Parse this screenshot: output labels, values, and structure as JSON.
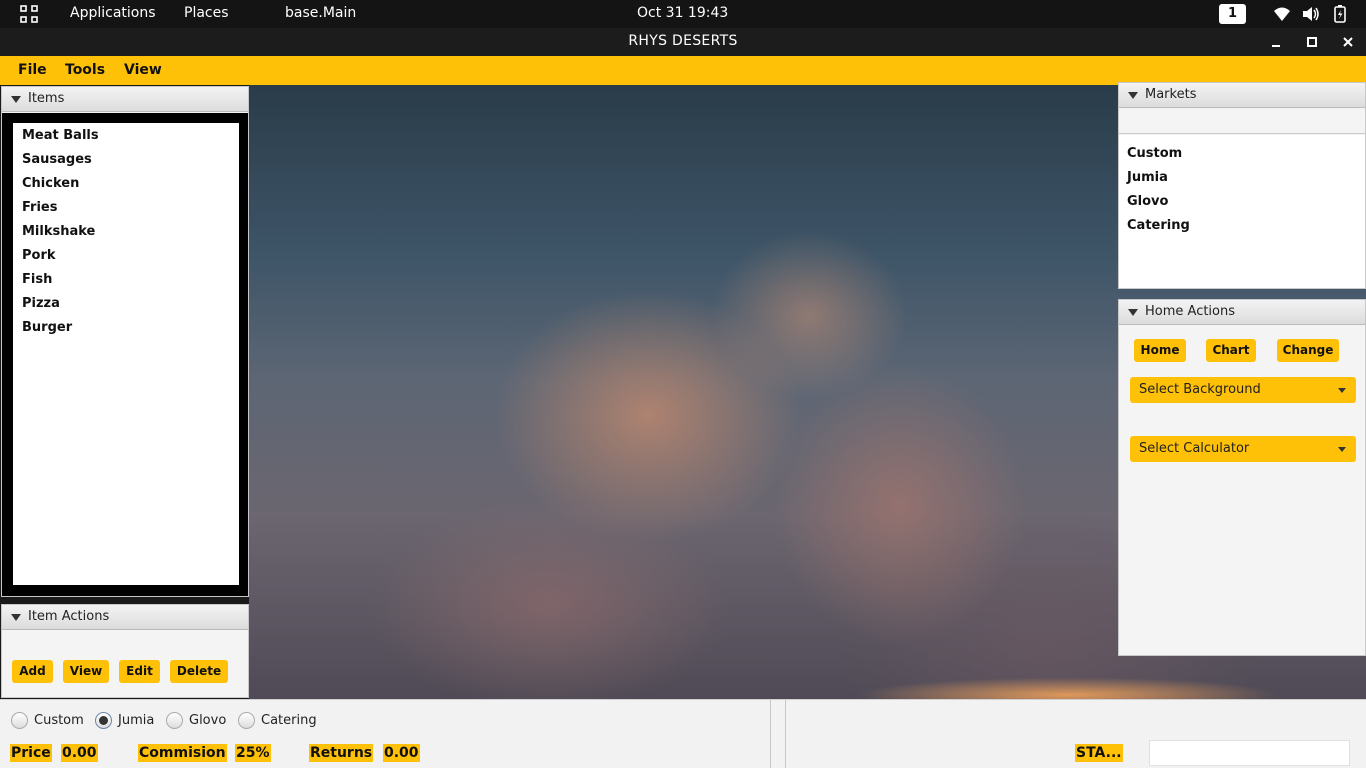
{
  "topbar": {
    "applications": "Applications",
    "places": "Places",
    "active_app": "base.Main",
    "clock": "Oct 31  19:43",
    "workspace": "1"
  },
  "window": {
    "title": "RHYS DESERTS"
  },
  "menubar": {
    "items": [
      "File",
      "Tools",
      "View"
    ]
  },
  "items_pane": {
    "title": "Items",
    "items": [
      "Meat Balls",
      "Sausages",
      "Chicken",
      "Fries",
      "Milkshake",
      "Pork",
      "Fish",
      "Pizza",
      "Burger"
    ]
  },
  "item_actions": {
    "title": "Item Actions",
    "buttons": [
      "Add",
      "View",
      "Edit",
      "Delete"
    ]
  },
  "markets_pane": {
    "title": "Markets",
    "search_value": "",
    "items": [
      "Custom",
      "Jumia",
      "Glovo",
      "Catering"
    ]
  },
  "home_actions": {
    "title": "Home Actions",
    "buttons": [
      "Home",
      "Chart",
      "Change"
    ],
    "background_combo": "Select Background",
    "calculator_combo": "Select Calculator"
  },
  "bottom": {
    "radios": [
      {
        "label": "Custom",
        "selected": false
      },
      {
        "label": "Jumia",
        "selected": true
      },
      {
        "label": "Glovo",
        "selected": false
      },
      {
        "label": "Catering",
        "selected": false
      }
    ],
    "price_label": "Price",
    "price_value": "0.00",
    "commission_label": "Commision",
    "commission_value": "25%",
    "returns_label": "Returns",
    "returns_value": "0.00",
    "status_label": "STA...",
    "status_value": ""
  },
  "colors": {
    "accent": "#ffc107",
    "topbar": "#141414",
    "pane_bg": "#f4f4f4"
  },
  "icons": {
    "activities": "grid-icon",
    "wifi": "wifi-icon",
    "volume": "volume-icon",
    "battery": "battery-icon",
    "minimize": "minimize-icon",
    "maximize": "maximize-icon",
    "close": "close-icon",
    "collapse": "triangle-down-icon",
    "dropdown": "chevron-down-icon"
  }
}
